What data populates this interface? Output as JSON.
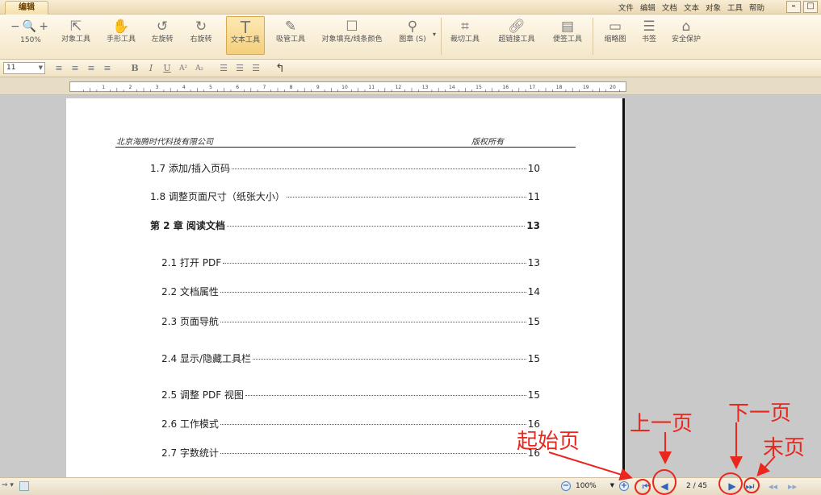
{
  "titlebar": {
    "tab": "编辑",
    "menus": [
      "文件",
      "编辑",
      "文档",
      "文本",
      "对象",
      "工具",
      "帮助"
    ],
    "win_min": "–",
    "win_max": "□"
  },
  "ribbon": {
    "zoom_label": "150%",
    "tools": [
      {
        "label": "对象工具",
        "icon": "pointer-icon"
      },
      {
        "label": "手形工具",
        "icon": "hand-icon"
      },
      {
        "label": "左旋转",
        "icon": "rotate-left-icon"
      },
      {
        "label": "右旋转",
        "icon": "rotate-right-icon"
      },
      {
        "label": "文本工具",
        "icon": "text-tool-icon"
      },
      {
        "label": "吸管工具",
        "icon": "eyedropper-icon"
      },
      {
        "label": "对象填充/线条颜色",
        "icon": "fill-color-icon"
      },
      {
        "label": "图章 (S)",
        "icon": "stamp-icon"
      },
      {
        "label": "裁切工具",
        "icon": "crop-icon"
      },
      {
        "label": "超链接工具",
        "icon": "link-icon"
      },
      {
        "label": "便签工具",
        "icon": "note-icon"
      },
      {
        "label": "缩略图",
        "icon": "thumbnail-icon"
      },
      {
        "label": "书签",
        "icon": "bookmark-icon"
      },
      {
        "label": "安全保护",
        "icon": "lock-icon"
      }
    ]
  },
  "format": {
    "font_size": "11",
    "bold": "B",
    "italic": "I",
    "underline": "U",
    "superscript": "A²",
    "subscript": "A₂"
  },
  "ruler": {
    "numbers": [
      "1",
      "2",
      "3",
      "4",
      "5",
      "6",
      "7",
      "8",
      "9",
      "10",
      "11",
      "12",
      "13",
      "14",
      "15",
      "16",
      "17",
      "18",
      "19",
      "20"
    ]
  },
  "document": {
    "header_left": "北京海腾时代科技有限公司",
    "header_right": "版权所有",
    "toc": [
      {
        "title": "1.7 添加/插入页码",
        "page": "10",
        "bold": false
      },
      {
        "title": "1.8 调整页面尺寸（纸张大小）",
        "page": "11",
        "bold": false
      },
      {
        "title": "第 2 章  阅读文档",
        "page": "13",
        "bold": true
      },
      {
        "title": "2.1 打开 PDF",
        "page": "13",
        "bold": false
      },
      {
        "title": "2.2 文档属性",
        "page": "14",
        "bold": false
      },
      {
        "title": "2.3 页面导航",
        "page": "15",
        "bold": false
      },
      {
        "title": "2.4 显示/隐藏工具栏",
        "page": "15",
        "bold": false
      },
      {
        "title": "2.5 调整 PDF 视图",
        "page": "15",
        "bold": false
      },
      {
        "title": "2.6 工作模式",
        "page": "16",
        "bold": false
      },
      {
        "title": "2.7 字数统计",
        "page": "16",
        "bold": false
      }
    ]
  },
  "status": {
    "zoom": "100%",
    "page_indicator": "2 / 45"
  },
  "annotations": {
    "first_page": "起始页",
    "prev_page": "上一页",
    "next_page": "下一页",
    "last_page": "末页"
  },
  "colors": {
    "annotation": "#e8281e",
    "nav_blue": "#2f66b8"
  }
}
